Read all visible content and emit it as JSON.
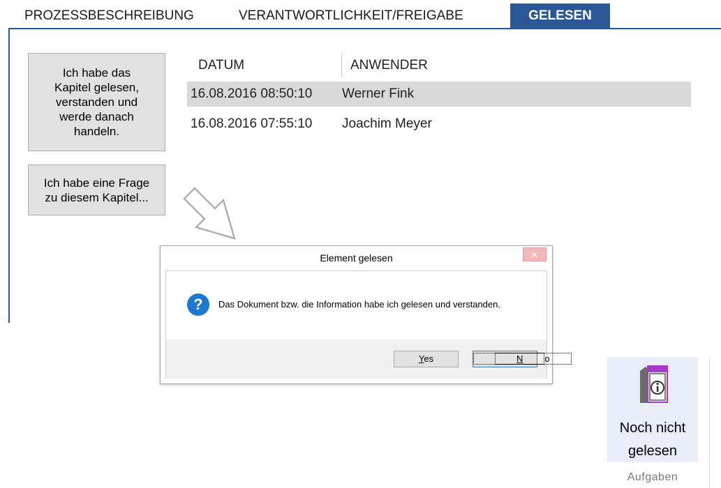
{
  "tabs": {
    "process": "PROZESSBESCHREIBUNG",
    "responsibility": "VERANTWORTLICHKEIT/FREIGABE",
    "read": "GELESEN"
  },
  "buttons": {
    "confirm_read": "Ich habe das\nKapitel gelesen,\nverstanden und\nwerde danach\nhandeln.",
    "question": "Ich habe eine Frage\nzu diesem Kapitel..."
  },
  "table": {
    "headers": {
      "date": "DATUM",
      "user": "ANWENDER"
    },
    "rows": [
      {
        "date": "16.08.2016 08:50:10",
        "user": "Werner Fink"
      },
      {
        "date": "16.08.2016 07:55:10",
        "user": "Joachim Meyer"
      }
    ]
  },
  "dialog": {
    "title": "Element gelesen",
    "close_glyph": "✕",
    "icon_glyph": "?",
    "message": "Das Dokument bzw. die Information habe ich gelesen und verstanden.",
    "yes_mnemonic": "Y",
    "yes_rest": "es",
    "no_mnemonic": "N",
    "no_rest": "o"
  },
  "ribbon": {
    "button_line1": "Noch nicht",
    "button_line2": "gelesen",
    "group_label": "Aufgaben"
  },
  "colors": {
    "accent": "#2b5797",
    "selected_row": "#d9d9d9",
    "book_purple": "#a23cc4"
  }
}
